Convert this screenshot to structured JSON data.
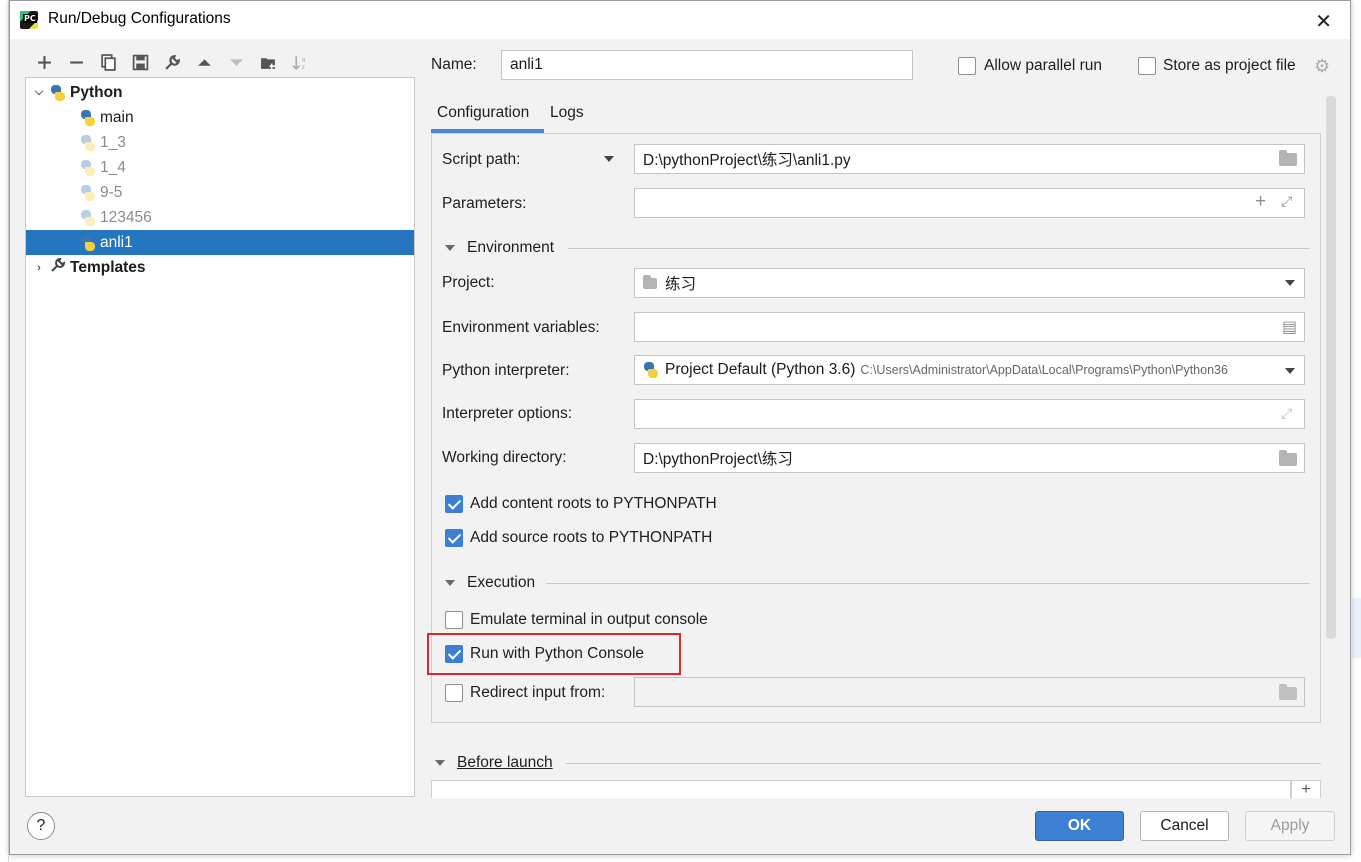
{
  "dialog": {
    "title": "Run/Debug Configurations",
    "close_glyph": "✕"
  },
  "toolbar": {
    "buttons": [
      "add",
      "remove",
      "copy",
      "save",
      "edit-defaults",
      "move-up",
      "move-down",
      "new-folder",
      "sort"
    ]
  },
  "tree": {
    "python_group": "Python",
    "items": [
      {
        "label": "main",
        "muted": false
      },
      {
        "label": "1_3",
        "muted": true
      },
      {
        "label": "1_4",
        "muted": true
      },
      {
        "label": "9-5",
        "muted": true
      },
      {
        "label": "123456",
        "muted": true
      },
      {
        "label": "anli1",
        "muted": false,
        "selected": true
      }
    ],
    "templates": "Templates"
  },
  "header": {
    "name_label": "Name:",
    "name_value": "anli1",
    "allow_parallel": "Allow parallel run",
    "store_project_file": "Store as project file"
  },
  "tabs": {
    "configuration": "Configuration",
    "logs": "Logs"
  },
  "config": {
    "script_path_label": "Script path:",
    "script_path_value": "D:\\pythonProject\\练习\\anli1.py",
    "parameters_label": "Parameters:",
    "parameters_value": "",
    "environment_section": "Environment",
    "project_label": "Project:",
    "project_value": "练习",
    "env_vars_label": "Environment variables:",
    "env_vars_value": "",
    "interpreter_label": "Python interpreter:",
    "interpreter_value": "Project Default (Python 3.6)",
    "interpreter_path": "C:\\Users\\Administrator\\AppData\\Local\\Programs\\Python\\Python36",
    "interp_options_label": "Interpreter options:",
    "interp_options_value": "",
    "working_dir_label": "Working directory:",
    "working_dir_value": "D:\\pythonProject\\练习",
    "add_content_roots": "Add content roots to PYTHONPATH",
    "add_content_roots_checked": true,
    "add_source_roots": "Add source roots to PYTHONPATH",
    "add_source_roots_checked": true,
    "execution_section": "Execution",
    "emulate_terminal": "Emulate terminal in output console",
    "emulate_terminal_checked": false,
    "run_with_console": "Run with Python Console",
    "run_with_console_checked": true,
    "redirect_input": "Redirect input from:",
    "redirect_input_checked": false,
    "redirect_input_value": ""
  },
  "before_launch": {
    "label": "Before launch",
    "add_glyph": "+"
  },
  "footer": {
    "help": "?",
    "ok": "OK",
    "cancel": "Cancel",
    "apply": "Apply"
  },
  "colors": {
    "selection": "#2675bf",
    "primary_button": "#3d7fd2",
    "highlight_box": "#e0262d"
  }
}
